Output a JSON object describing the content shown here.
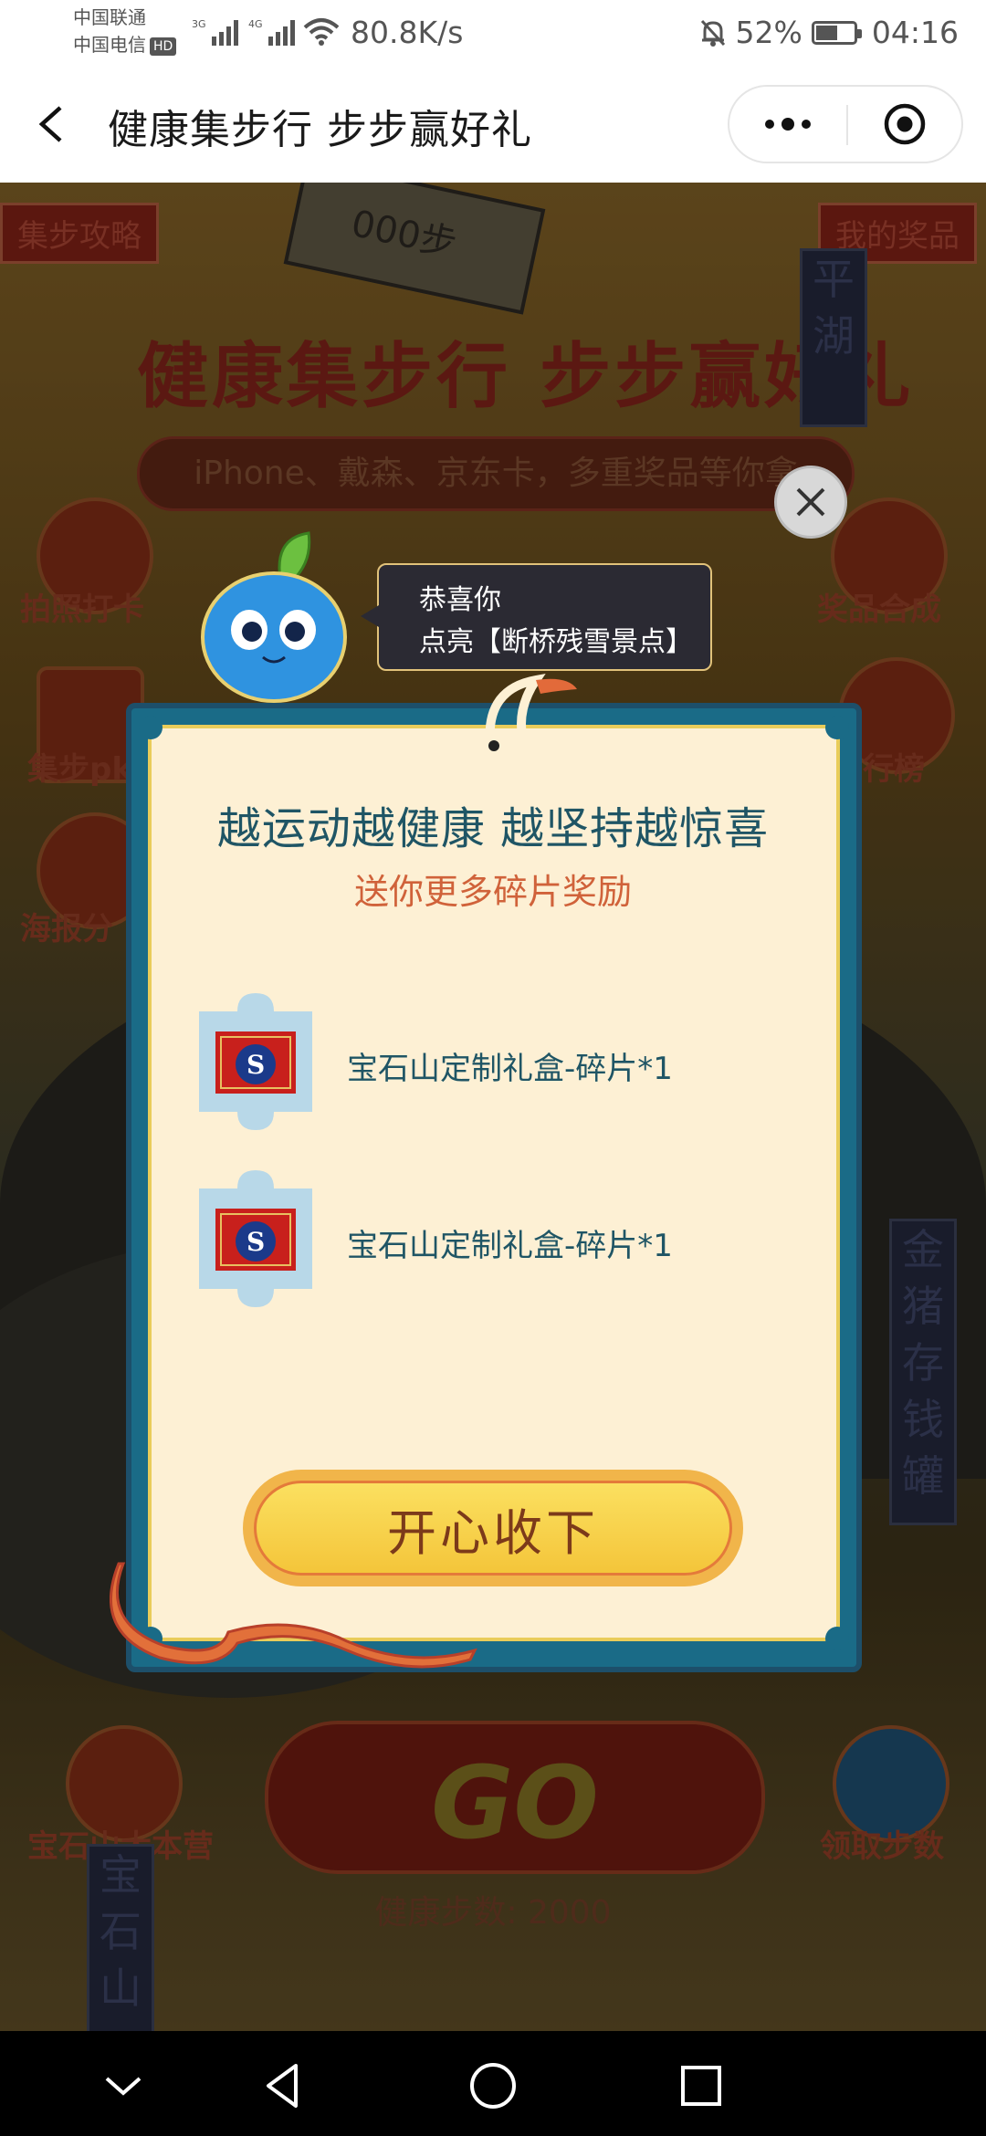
{
  "status_bar": {
    "carrier1": "中国联通",
    "carrier2": "中国电信",
    "hd_badge": "HD",
    "net1": "3G",
    "net2": "4G",
    "speed": "80.8K/s",
    "battery": "52%",
    "battery_level": 0.52,
    "time": "04:16"
  },
  "titlebar": {
    "title": "健康集步行 步步赢好礼"
  },
  "background": {
    "strategy": "集步攻略",
    "my_prizes": "我的奖品",
    "big_title": "健康集步行 步步赢好礼",
    "subtitle": "iPhone、戴森、京东卡，多重奖品等你拿",
    "photo_checkin": "拍照打卡",
    "steps_pk": "集步pk",
    "poster_share": "海报分",
    "prize_compose": "奖品合成",
    "ranking": "行榜",
    "golden_pig": "金猪存钱罐",
    "base_camp": "宝石山大本营",
    "get_steps": "领取步数",
    "go": "GO",
    "health_steps": "健康步数: 2000",
    "scenic1": "平湖",
    "scenic2": "宝石山",
    "sign": "000步"
  },
  "popup": {
    "bubble_line1": "恭喜你",
    "bubble_line2": "点亮【断桥残雪景点】",
    "title": "越运动越健康 越坚持越惊喜",
    "subtitle": "送你更多碎片奖励",
    "rewards": [
      {
        "label": "宝石山定制礼盒-碎片*1"
      },
      {
        "label": "宝石山定制礼盒-碎片*1"
      }
    ],
    "confirm": "开心收下"
  },
  "colors": {
    "card_teal": "#1a6b87",
    "card_cream": "#fdf0d4",
    "title_teal": "#1f5565",
    "subtitle_orange": "#d0623a",
    "button_yellow": "#f4c53a"
  }
}
